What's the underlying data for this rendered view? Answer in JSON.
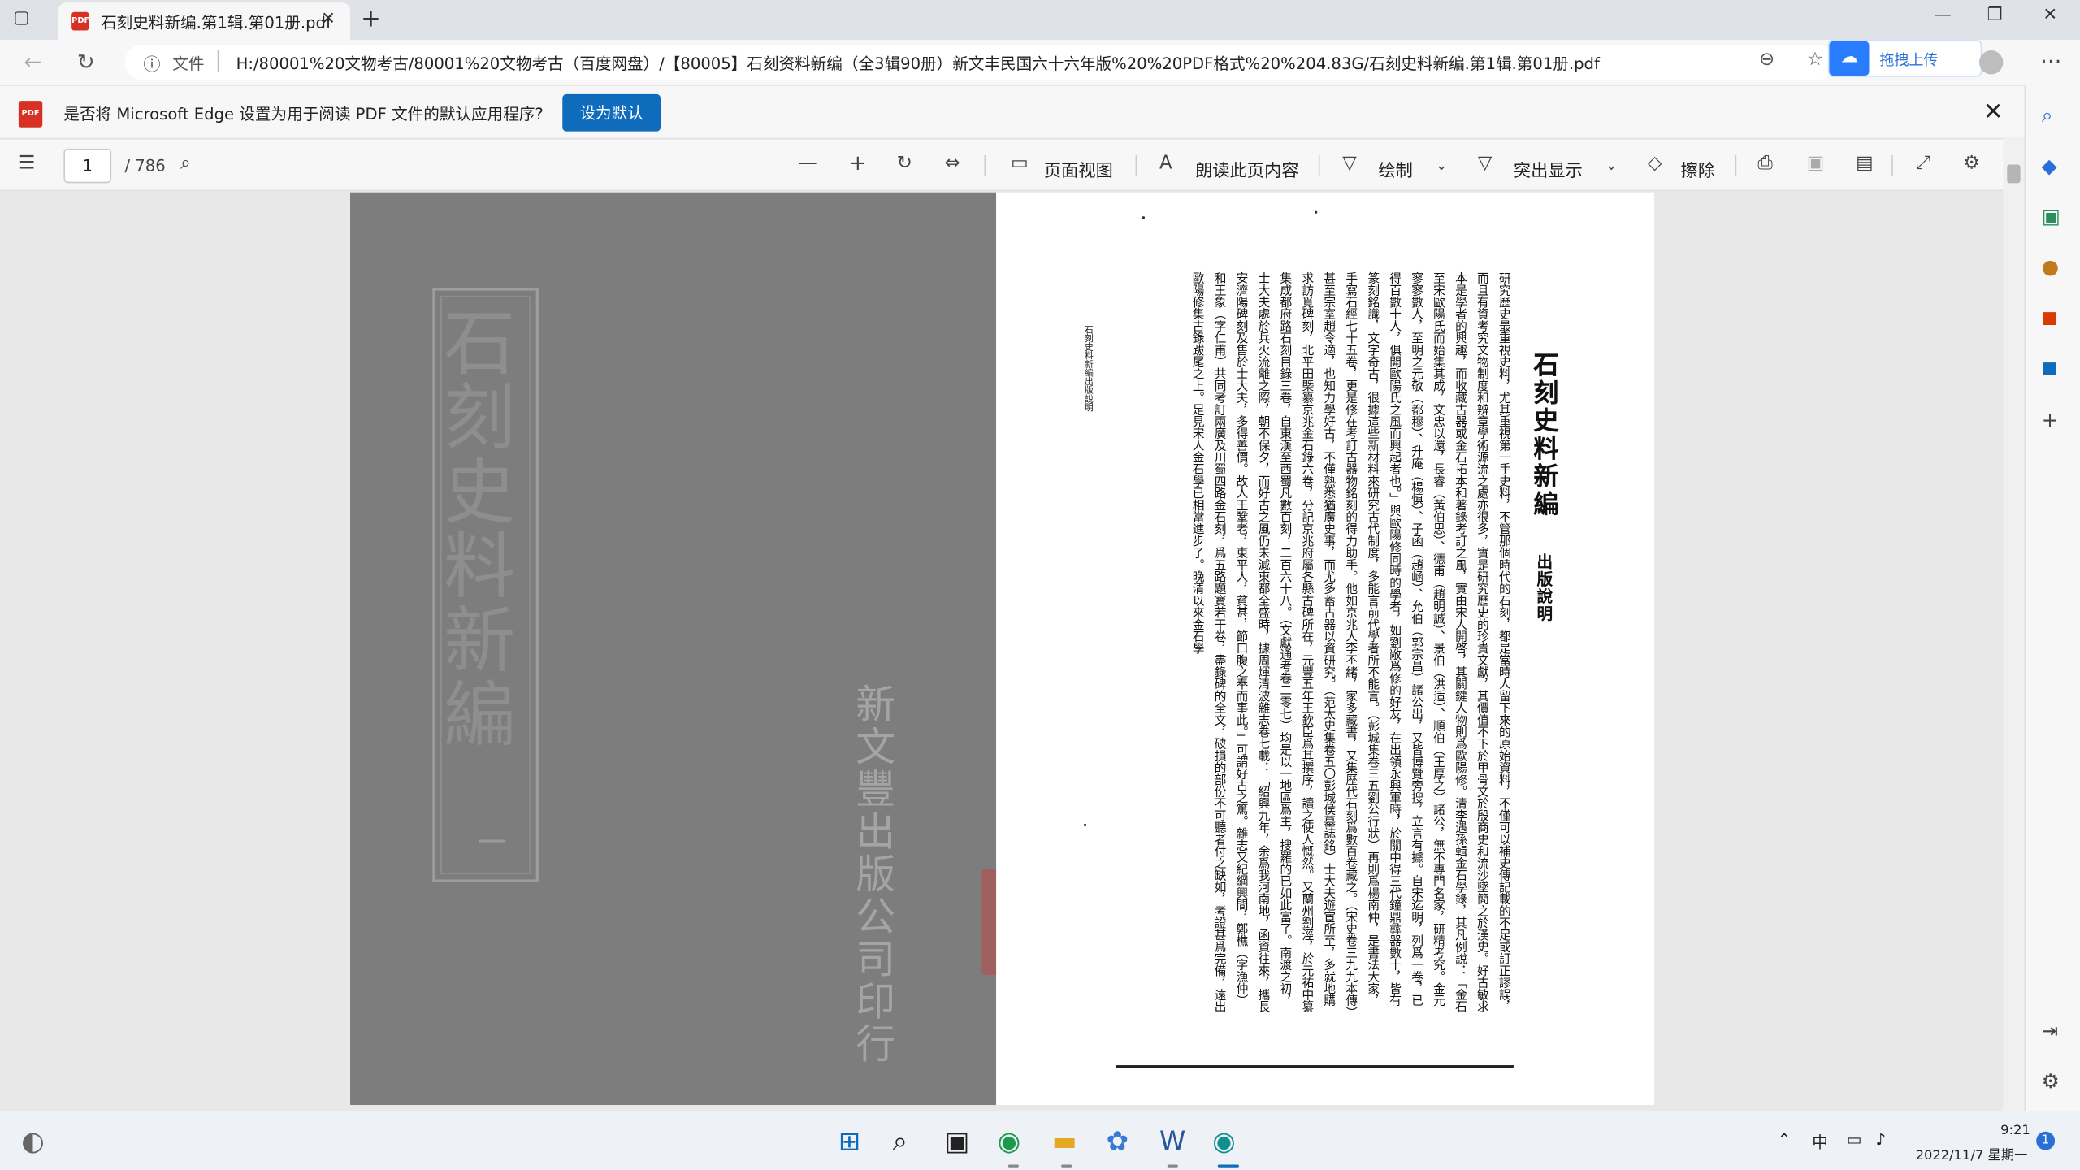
{
  "browser": {
    "tab_title": "石刻史料新编.第1辑.第01册.pdf",
    "file_label": "文件",
    "url": "H:/80001%20文物考古/80001%20文物考古（百度网盘）/【80005】石刻资料新编（全3辑90册）新文丰民国六十六年版%20%20PDF格式%20%204.83G/石刻史料新编.第1辑.第01册.pdf",
    "extension_label": "拖拽上传"
  },
  "notice": {
    "message": "是否将 Microsoft Edge 设置为用于阅读 PDF 文件的默认应用程序?",
    "button": "设为默认"
  },
  "pdf_toolbar": {
    "page_current": "1",
    "page_total": "/ 786",
    "page_view": "页面视图",
    "read_aloud": "朗读此页内容",
    "draw": "绘制",
    "highlight": "突出显示",
    "erase": "擦除"
  },
  "cover": {
    "title": "石刻史料新編",
    "volume": "一",
    "publisher": "新文豐出版公司印行"
  },
  "page": {
    "title": "石刻史料新編",
    "subtitle": "出版說明",
    "side_note": "石刻史料新編出版說明",
    "body": "研究歷史最重視史料，尤其重視第一手史料，不管那個時代的石刻，都是當時人留下來的原始資料，不僅可以補史傳記載的不足或訂正謬誤，而且有資考究文物制度和辨章學術源流之處亦很多，實是研究歷史的珍貴文獻，其價值不下於甲骨文於殷商史和流沙墜簡之於漢史。好古敏求本是學者的興趣，而收藏古器或金石拓本和著錄考訂之風，實由宋人開啓，其關鍵人物則爲歐陽修。清李遇孫輯金石學錄，其凡例說：「金石至宋歐陽氏而始集其成，文忠以還，長睿（黃伯思）、德甫（趙明誠）、景伯（洪适）、順伯（王厚之）諸公，無不專門名家，研精考究。金元寥寥數人，至明之元敬（都穆）、升庵（楊慎）、子函（趙崡）、允伯（郭宗昌）諸公出，又皆博覽旁搜，立言有據。自宋迄明，列爲一卷，已得百數十人，俱開歐陽氏之風而興起者也。」與歐陽修同時的學者，如劉敞爲修的好友，在出領永興軍時，於關中得三代鐘鼎彝器數十，皆有篆刻銘識，文字奇古，很據這些新材料來研究古代制度，多能言前代學者所不能言。（彭城集卷三五劉公行狀）再則爲楊南仲，是書法大家，手寫石經七十五卷，更是修在考訂古器物銘刻的得力助手。他如京兆人李丕緒，家多藏書，又集歷代石刻爲數百卷藏之。（宋史卷三九九本傳）甚至宗室趙令適，也知力學好古，不僅熟悉猶廣史事，而尤多蓄古器以資研究。（范太史集卷五〇彭城侯墓誌銘）士大夫遊宦所至，多就地購求訪覓碑刻，北平田槩纂京兆金石錄六卷，分記京兆府屬各縣古碑所在，元豐五年王欽臣爲其撰序，讀之使人慨然。又蘭州劉涇，於元祐中纂集成都府路石刻目錄三卷，自東漢至西蜀凡數百刻，二百六十八。（文獻通考卷二零七）均是以一地區爲主，搜羅的已如此富了。南渡之初，士大夫處於兵火流離之際，朝不保夕，而好古之風仍未減東都全盛時，據周煇清波雜志卷七載：「紹興九年，余爲我河南地，函資往來，攜長安濟陽碑刻及售於士大夫，多得善價。故人王鞏老，東平人，貧甚，節口腹之奉而事此。」可謂好古之篤。雜志又紀綱興間，鄭樵（字漁仲）和王象（字仁甫）共同考訂兩廣及川蜀四路金石刻，爲五路題寶若干卷，盡錄碑的全文，破損的部份不可聽者付之缺如，考證甚爲完備，遠出歐陽修集古錄跋尾之上。足見宋人金石學已相當進步了。晚清以來金石學"
  },
  "taskbar": {
    "ime": "中",
    "time": "9:21",
    "date": "2022/11/7 星期一",
    "notifications": "1"
  }
}
